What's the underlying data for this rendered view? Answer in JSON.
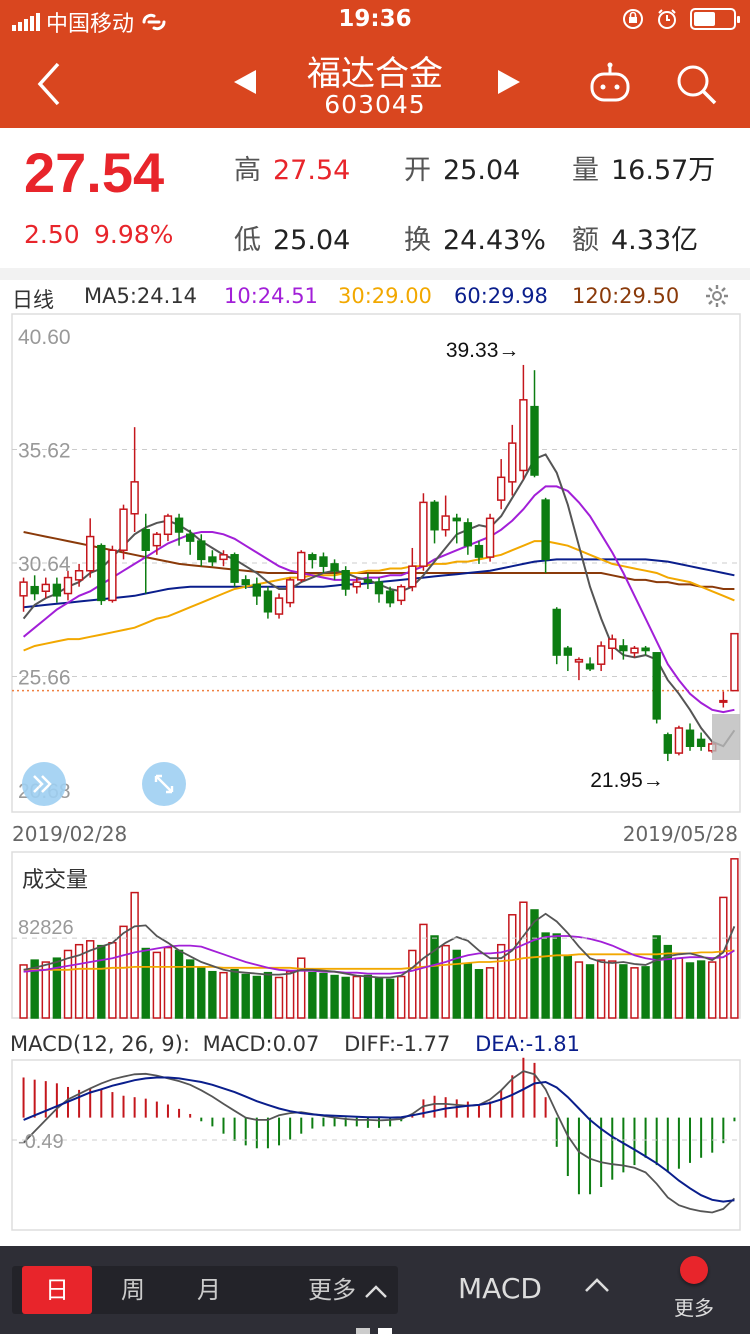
{
  "status": {
    "carrier": "中国移动",
    "time": "19:36"
  },
  "nav": {
    "title": "福达合金",
    "code": "603045"
  },
  "quote": {
    "price": "27.54",
    "change": "2.50",
    "change_pct": "9.98%",
    "high_label": "高",
    "high": "27.54",
    "open_label": "开",
    "open": "25.04",
    "vol_label": "量",
    "vol": "16.57万",
    "low_label": "低",
    "low": "25.04",
    "turnover_label": "换",
    "turnover": "24.43%",
    "amount_label": "额",
    "amount": "4.33亿"
  },
  "ma": {
    "period": "日线",
    "ma5": "MA5:24.14",
    "ma10": "10:24.51",
    "ma30": "30:29.00",
    "ma60": "60:29.98",
    "ma120": "120:29.50"
  },
  "colors": {
    "ma5": "#555555",
    "ma10": "#a21fd8",
    "ma30": "#f2a800",
    "ma60": "#0a1e8c",
    "ma120": "#8a3a0a",
    "up": "#c4161c",
    "down": "#0d7d12"
  },
  "chart_data": {
    "type": "candlestick",
    "y_ticks": [
      "40.60",
      "35.62",
      "30.64",
      "25.66",
      "20.68"
    ],
    "y_range": [
      20.68,
      40.6
    ],
    "max_label": "39.33→",
    "min_label": "21.95→",
    "date_start": "2019/02/28",
    "date_end": "2019/05/28",
    "candles": [
      [
        29.2,
        29.8,
        28.5,
        30.0
      ],
      [
        29.6,
        29.3,
        29.0,
        30.1
      ],
      [
        29.4,
        29.7,
        29.1,
        30.0
      ],
      [
        29.7,
        29.2,
        28.9,
        30.0
      ],
      [
        29.3,
        30.0,
        29.0,
        30.3
      ],
      [
        29.9,
        30.3,
        29.6,
        30.6
      ],
      [
        30.3,
        31.8,
        30.0,
        32.6
      ],
      [
        31.4,
        29.0,
        28.8,
        31.5
      ],
      [
        29.0,
        31.2,
        28.9,
        31.4
      ],
      [
        31.2,
        33.0,
        30.8,
        33.2
      ],
      [
        32.8,
        34.2,
        32.0,
        36.6
      ],
      [
        32.1,
        31.2,
        29.3,
        32.8
      ],
      [
        31.4,
        31.9,
        31.0,
        32.0
      ],
      [
        31.9,
        32.7,
        31.6,
        32.8
      ],
      [
        32.6,
        32.0,
        31.4,
        32.8
      ],
      [
        31.9,
        31.6,
        31.0,
        32.1
      ],
      [
        31.6,
        30.8,
        30.5,
        31.9
      ],
      [
        30.9,
        30.7,
        30.5,
        31.2
      ],
      [
        30.8,
        31.0,
        30.5,
        31.2
      ],
      [
        31.0,
        29.8,
        29.6,
        31.1
      ],
      [
        29.9,
        29.7,
        29.5,
        30.1
      ],
      [
        29.7,
        29.2,
        28.8,
        30.0
      ],
      [
        29.4,
        28.5,
        28.2,
        29.6
      ],
      [
        28.4,
        29.1,
        28.2,
        29.3
      ],
      [
        28.9,
        29.9,
        28.7,
        30.0
      ],
      [
        29.9,
        31.1,
        29.8,
        31.2
      ],
      [
        31.0,
        30.8,
        30.4,
        31.1
      ],
      [
        30.9,
        30.5,
        30.2,
        31.1
      ],
      [
        30.6,
        30.3,
        29.9,
        30.8
      ],
      [
        30.3,
        29.5,
        29.2,
        30.5
      ],
      [
        29.6,
        29.8,
        29.3,
        30.0
      ],
      [
        29.9,
        29.8,
        29.5,
        30.2
      ],
      [
        29.8,
        29.3,
        28.9,
        30.0
      ],
      [
        29.4,
        28.9,
        28.7,
        29.6
      ],
      [
        29.0,
        29.6,
        28.8,
        29.7
      ],
      [
        29.6,
        30.5,
        29.4,
        31.3
      ],
      [
        30.5,
        33.3,
        30.3,
        33.7
      ],
      [
        33.3,
        32.1,
        31.5,
        33.4
      ],
      [
        32.1,
        32.7,
        31.8,
        33.6
      ],
      [
        32.6,
        32.5,
        31.5,
        32.8
      ],
      [
        32.4,
        31.4,
        31.0,
        32.6
      ],
      [
        31.4,
        30.9,
        30.6,
        31.6
      ],
      [
        30.9,
        32.6,
        30.7,
        32.8
      ],
      [
        33.4,
        34.4,
        33.0,
        35.2
      ],
      [
        34.2,
        35.9,
        33.6,
        36.7
      ],
      [
        34.7,
        37.8,
        34.3,
        39.33
      ],
      [
        37.5,
        34.5,
        34.4,
        39.1
      ],
      [
        33.4,
        30.8,
        30.2,
        33.5
      ],
      [
        28.6,
        26.6,
        26.2,
        28.7
      ],
      [
        26.9,
        26.6,
        25.9,
        27.0
      ],
      [
        26.3,
        26.4,
        25.5,
        26.5
      ],
      [
        26.2,
        26.0,
        25.9,
        26.5
      ],
      [
        26.2,
        27.0,
        25.9,
        27.2
      ],
      [
        26.9,
        27.3,
        26.4,
        27.5
      ],
      [
        27.0,
        26.8,
        26.4,
        27.3
      ],
      [
        26.7,
        26.9,
        26.5,
        27.0
      ],
      [
        26.9,
        26.8,
        26.6,
        27.0
      ],
      [
        26.7,
        23.8,
        23.6,
        26.7
      ],
      [
        23.1,
        22.3,
        21.95,
        23.2
      ],
      [
        22.3,
        23.4,
        22.2,
        23.5
      ],
      [
        23.3,
        22.6,
        22.4,
        23.6
      ],
      [
        22.9,
        22.6,
        22.4,
        23.2
      ],
      [
        22.4,
        22.7,
        22.3,
        22.8
      ],
      [
        24.6,
        24.6,
        24.3,
        25.0
      ],
      [
        25.04,
        27.54,
        25.04,
        27.54
      ]
    ],
    "ma5": [
      28.2,
      28.8,
      29.1,
      29.3,
      29.6,
      29.8,
      30.2,
      30.4,
      30.9,
      31.4,
      31.9,
      32.2,
      32.4,
      32.5,
      32.3,
      32.0,
      31.6,
      31.3,
      31.0,
      30.8,
      30.5,
      30.2,
      29.8,
      29.5,
      29.5,
      29.8,
      30.0,
      30.2,
      30.3,
      30.2,
      30.0,
      29.9,
      29.7,
      29.5,
      29.4,
      29.6,
      30.1,
      30.7,
      31.3,
      31.9,
      32.1,
      32.3,
      32.2,
      32.7,
      33.5,
      34.3,
      35.2,
      35.4,
      34.6,
      33.2,
      31.4,
      29.6,
      28.2,
      27.0,
      26.6,
      26.5,
      26.6,
      26.4,
      25.5,
      24.9,
      24.2,
      23.4,
      22.8,
      22.6,
      23.3
    ],
    "ma10": [
      27.4,
      27.8,
      28.2,
      28.6,
      28.9,
      29.2,
      29.4,
      29.7,
      30.0,
      30.3,
      30.6,
      30.9,
      31.2,
      31.5,
      31.7,
      31.9,
      32.0,
      32.0,
      31.9,
      31.7,
      31.4,
      31.1,
      30.8,
      30.5,
      30.3,
      30.2,
      30.1,
      30.0,
      29.9,
      29.9,
      29.9,
      30.0,
      30.0,
      30.1,
      30.1,
      30.3,
      30.5,
      30.8,
      31.0,
      31.2,
      31.4,
      31.6,
      31.8,
      32.1,
      32.5,
      33.0,
      33.6,
      34.0,
      34.0,
      33.8,
      33.3,
      32.7,
      31.9,
      31.1,
      30.2,
      29.2,
      28.2,
      27.2,
      26.2,
      25.5,
      24.9,
      24.5,
      24.2,
      24.1,
      24.2
    ],
    "ma30": [
      26.8,
      27.0,
      27.1,
      27.2,
      27.3,
      27.3,
      27.4,
      27.5,
      27.6,
      27.7,
      27.8,
      28.0,
      28.2,
      28.3,
      28.5,
      28.7,
      28.9,
      29.1,
      29.3,
      29.5,
      29.6,
      29.7,
      29.8,
      29.9,
      30.0,
      30.0,
      30.1,
      30.1,
      30.1,
      30.2,
      30.2,
      30.3,
      30.3,
      30.4,
      30.4,
      30.5,
      30.5,
      30.6,
      30.6,
      30.7,
      30.7,
      30.8,
      30.9,
      31.0,
      31.2,
      31.4,
      31.6,
      31.6,
      31.5,
      31.4,
      31.2,
      31.0,
      30.8,
      30.6,
      30.5,
      30.4,
      30.3,
      30.2,
      30.0,
      29.9,
      29.8,
      29.6,
      29.4,
      29.2,
      29.0
    ],
    "ma60": [
      28.7,
      28.75,
      28.8,
      28.85,
      28.9,
      28.95,
      29.0,
      29.05,
      29.1,
      29.15,
      29.2,
      29.3,
      29.4,
      29.5,
      29.55,
      29.6,
      29.6,
      29.6,
      29.6,
      29.6,
      29.6,
      29.6,
      29.6,
      29.6,
      29.6,
      29.6,
      29.6,
      29.6,
      29.65,
      29.7,
      29.7,
      29.75,
      29.8,
      29.85,
      29.9,
      29.95,
      30.0,
      30.05,
      30.1,
      30.15,
      30.2,
      30.25,
      30.3,
      30.4,
      30.5,
      30.6,
      30.7,
      30.75,
      30.8,
      30.8,
      30.8,
      30.8,
      30.8,
      30.8,
      30.8,
      30.8,
      30.8,
      30.75,
      30.7,
      30.6,
      30.5,
      30.4,
      30.3,
      30.2,
      30.1
    ],
    "ma120": [
      32.0,
      31.9,
      31.8,
      31.7,
      31.6,
      31.5,
      31.4,
      31.3,
      31.2,
      31.1,
      31.0,
      30.9,
      30.8,
      30.7,
      30.6,
      30.55,
      30.5,
      30.45,
      30.4,
      30.35,
      30.3,
      30.25,
      30.2,
      30.2,
      30.2,
      30.2,
      30.2,
      30.2,
      30.2,
      30.2,
      30.2,
      30.2,
      30.2,
      30.2,
      30.2,
      30.2,
      30.2,
      30.2,
      30.2,
      30.2,
      30.2,
      30.2,
      30.2,
      30.2,
      30.2,
      30.2,
      30.2,
      30.2,
      30.2,
      30.2,
      30.2,
      30.2,
      30.2,
      30.1,
      30.0,
      29.9,
      29.9,
      29.8,
      29.8,
      29.7,
      29.7,
      29.6,
      29.6,
      29.5,
      29.5
    ],
    "volume_title": "成交量",
    "volume_tick": "82826",
    "volume": [
      55000,
      60000,
      58000,
      62000,
      70000,
      76000,
      80000,
      75000,
      78000,
      95000,
      130000,
      72000,
      68000,
      73000,
      70000,
      60000,
      52000,
      48000,
      47000,
      50000,
      45000,
      43000,
      47000,
      42000,
      48000,
      62000,
      47000,
      46000,
      44000,
      42000,
      43000,
      44000,
      41000,
      40000,
      43000,
      70000,
      97000,
      85000,
      75000,
      70000,
      56000,
      50000,
      52000,
      76000,
      107000,
      120000,
      112000,
      88000,
      87000,
      65000,
      58000,
      55000,
      60000,
      59000,
      55000,
      52000,
      53000,
      85000,
      75000,
      62000,
      57000,
      59000,
      58000,
      125000,
      165000
    ],
    "vol_ma1": [
      50000,
      52000,
      55000,
      58000,
      62000,
      65000,
      70000,
      74000,
      78000,
      88000,
      95000,
      96000,
      85000,
      78000,
      70000,
      64000,
      58000,
      54000,
      50000,
      48000,
      47000,
      46000,
      45000,
      45000,
      46000,
      50000,
      50000,
      49000,
      48000,
      46000,
      44000,
      43000,
      42000,
      42000,
      44000,
      52000,
      62000,
      70000,
      78000,
      84000,
      80000,
      70000,
      62000,
      62000,
      70000,
      85000,
      100000,
      108000,
      100000,
      88000,
      74000,
      62000,
      58000,
      57000,
      58000,
      56000,
      55000,
      60000,
      64000,
      66000,
      67000,
      64000,
      60000,
      68000,
      95000
    ],
    "vol_ma2": [
      48000,
      49000,
      50000,
      52000,
      54000,
      56000,
      58000,
      60000,
      62000,
      65000,
      68000,
      70000,
      72000,
      74000,
      75000,
      75000,
      74000,
      70000,
      66000,
      62000,
      58000,
      55000,
      52000,
      50000,
      49000,
      49000,
      49000,
      48000,
      48000,
      47000,
      47000,
      46000,
      46000,
      46000,
      47000,
      49000,
      52000,
      55000,
      58000,
      62000,
      65000,
      67000,
      67000,
      68000,
      71000,
      76000,
      81000,
      84000,
      85000,
      85000,
      84000,
      82000,
      79000,
      75000,
      70000,
      65000,
      62000,
      60000,
      61000,
      62000,
      63000,
      63000,
      62000,
      63000,
      70000
    ],
    "vol_ma3": [
      50000,
      50000,
      50000,
      50000,
      50000,
      51000,
      51000,
      51000,
      52000,
      52000,
      53000,
      53000,
      53000,
      53000,
      53000,
      53000,
      53000,
      53000,
      52000,
      52000,
      52000,
      52000,
      52000,
      52000,
      52000,
      51000,
      51000,
      51000,
      51000,
      51000,
      51000,
      51000,
      51000,
      51000,
      51000,
      52000,
      53000,
      54000,
      55000,
      56000,
      57000,
      58000,
      58000,
      59000,
      60000,
      62000,
      63000,
      64000,
      65000,
      65000,
      66000,
      66000,
      66000,
      66000,
      66000,
      66000,
      66000,
      66000,
      67000,
      67000,
      67000,
      68000,
      68000,
      69000,
      70000
    ],
    "macd_header": {
      "title": "MACD(12, 26, 9):",
      "macd": "MACD:0.07",
      "diff": "DIFF:-1.77",
      "dea": "DEA:-1.81"
    },
    "macd_tick": "-0.49",
    "macd_range": [
      -2.2,
      1.0
    ],
    "macd_hist": [
      0.55,
      0.52,
      0.5,
      0.47,
      0.42,
      0.38,
      0.4,
      0.38,
      0.35,
      0.3,
      0.28,
      0.26,
      0.22,
      0.18,
      0.12,
      0.05,
      -0.05,
      -0.12,
      -0.22,
      -0.32,
      -0.38,
      -0.42,
      -0.42,
      -0.38,
      -0.3,
      -0.22,
      -0.15,
      -0.12,
      -0.12,
      -0.12,
      -0.12,
      -0.14,
      -0.14,
      -0.12,
      -0.05,
      0.05,
      0.25,
      0.3,
      0.28,
      0.25,
      0.22,
      0.18,
      0.22,
      0.38,
      0.58,
      0.82,
      0.75,
      0.28,
      -0.4,
      -0.8,
      -1.05,
      -1.05,
      -0.95,
      -0.85,
      -0.75,
      -0.65,
      -0.55,
      -0.65,
      -0.75,
      -0.7,
      -0.62,
      -0.55,
      -0.48,
      -0.35,
      -0.05
    ],
    "macd_diff": [
      -0.55,
      -0.3,
      -0.05,
      0.2,
      0.4,
      0.52,
      0.64,
      0.75,
      0.84,
      0.9,
      0.95,
      0.96,
      0.92,
      0.86,
      0.8,
      0.72,
      0.6,
      0.46,
      0.3,
      0.15,
      0.0,
      -0.05,
      -0.05,
      0.05,
      0.1,
      0.12,
      0.08,
      0.04,
      0.0,
      -0.03,
      -0.05,
      -0.05,
      -0.06,
      -0.05,
      -0.03,
      0.08,
      0.25,
      0.3,
      0.3,
      0.28,
      0.26,
      0.28,
      0.4,
      0.6,
      0.85,
      1.02,
      0.95,
      0.62,
      0.1,
      -0.4,
      -0.75,
      -0.9,
      -0.98,
      -1.02,
      -1.05,
      -1.1,
      -1.2,
      -1.45,
      -1.75,
      -1.92,
      -2.0,
      -2.05,
      -2.08,
      -2.0,
      -1.77
    ],
    "macd_dea": [
      -0.05,
      0.05,
      0.15,
      0.25,
      0.35,
      0.45,
      0.55,
      0.62,
      0.7,
      0.76,
      0.82,
      0.86,
      0.88,
      0.88,
      0.86,
      0.82,
      0.78,
      0.72,
      0.64,
      0.56,
      0.46,
      0.36,
      0.28,
      0.2,
      0.14,
      0.1,
      0.07,
      0.05,
      0.04,
      0.03,
      0.02,
      0.01,
      0.01,
      0.0,
      0.01,
      0.05,
      0.1,
      0.15,
      0.2,
      0.23,
      0.26,
      0.28,
      0.32,
      0.4,
      0.5,
      0.62,
      0.75,
      0.78,
      0.66,
      0.45,
      0.2,
      -0.05,
      -0.25,
      -0.42,
      -0.56,
      -0.7,
      -0.85,
      -1.0,
      -1.18,
      -1.38,
      -1.55,
      -1.7,
      -1.8,
      -1.84,
      -1.81
    ]
  },
  "bottom": {
    "day": "日",
    "week": "周",
    "month": "月",
    "more": "更多",
    "indicator": "MACD",
    "more2": "更多"
  }
}
